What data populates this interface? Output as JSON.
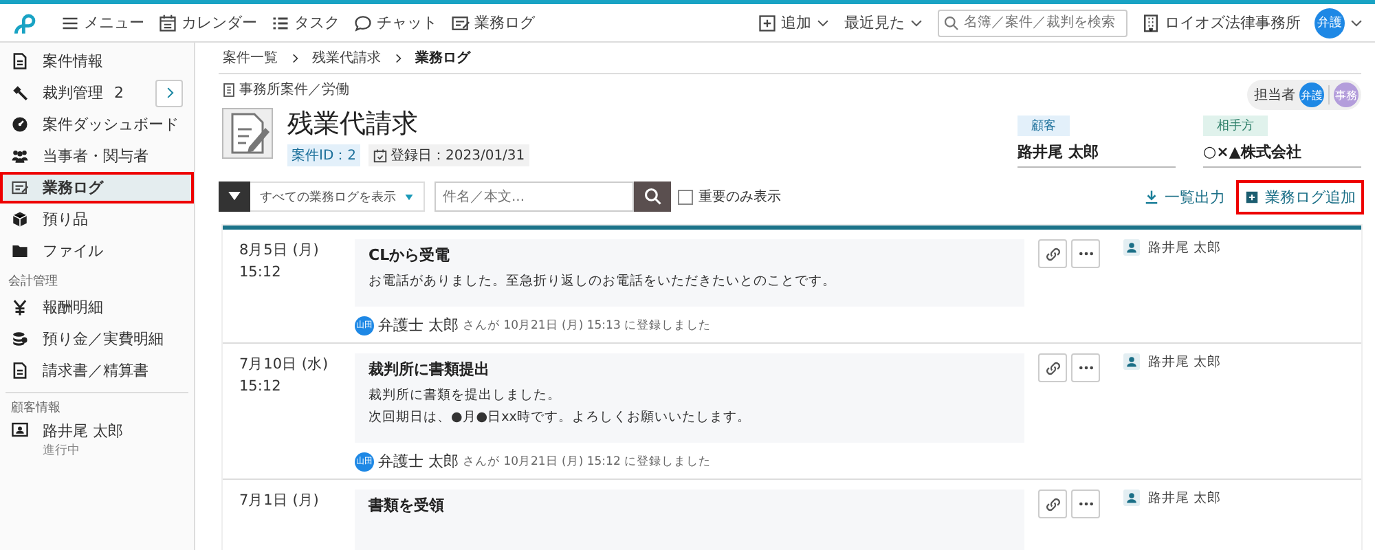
{
  "topbar": {
    "nav": [
      {
        "label": "メニュー",
        "kind": "menu"
      },
      {
        "label": "カレンダー",
        "kind": "calendar"
      },
      {
        "label": "タスク",
        "kind": "list"
      },
      {
        "label": "チャット",
        "kind": "chat"
      },
      {
        "label": "業務ログ",
        "kind": "log"
      }
    ],
    "add": "追加",
    "recent": "最近見た",
    "search": {
      "placeholder": "名簿／案件／裁判を検索"
    },
    "office": "ロイオズ法律事務所",
    "user_initials": "弁護"
  },
  "sidebar": {
    "sections": [
      {
        "items": [
          {
            "label": "案件情報",
            "kind": "doc",
            "selected": false,
            "highlighted": false
          },
          {
            "label": "裁判管理",
            "kind": "gavel",
            "count": "2",
            "expandable": true,
            "selected": false,
            "highlighted": false
          },
          {
            "label": "案件ダッシュボード",
            "kind": "gauge",
            "selected": false,
            "highlighted": false
          },
          {
            "label": "当事者・関与者",
            "kind": "people",
            "selected": false,
            "highlighted": false
          },
          {
            "label": "業務ログ",
            "kind": "log",
            "selected": true,
            "highlighted": true
          },
          {
            "label": "預り品",
            "kind": "box",
            "selected": false,
            "highlighted": false
          },
          {
            "label": "ファイル",
            "kind": "folder",
            "selected": false,
            "highlighted": false
          }
        ]
      },
      {
        "heading": "会計管理",
        "items": [
          {
            "label": "報酬明細",
            "kind": "yen",
            "selected": false,
            "highlighted": false
          },
          {
            "label": "預り金／実費明細",
            "kind": "coins",
            "selected": false,
            "highlighted": false
          },
          {
            "label": "請求書／精算書",
            "kind": "doc",
            "selected": false,
            "highlighted": false
          }
        ]
      },
      {
        "heading": "顧客情報",
        "items": [
          {
            "label": "路井尾 太郎",
            "sublabel": "進行中",
            "kind": "contact",
            "selected": false,
            "highlighted": false
          }
        ]
      }
    ]
  },
  "breadcrumb": [
    "案件一覧",
    "残業代請求",
    "業務ログ"
  ],
  "case": {
    "category": "事務所案件／労働",
    "title": "残業代請求",
    "id": "案件ID：2",
    "registered": "登録日：2023/01/31",
    "assignees_label": "担当者",
    "assignees": [
      {
        "initials": "弁護",
        "color": "#1e88e5"
      },
      {
        "initials": "事務",
        "color": "#b39ddb"
      }
    ],
    "parties": [
      {
        "role": "顧客",
        "name": "路井尾 太郎",
        "kind": "client"
      },
      {
        "role": "相手方",
        "name": "○×▲株式会社",
        "kind": "opponent"
      }
    ]
  },
  "toolbar": {
    "filter": "すべての業務ログを表示",
    "search": {
      "placeholder": "件名／本文..."
    },
    "important_only": {
      "label": "重要のみ表示",
      "checked": false
    },
    "export": "一覧出力",
    "add": {
      "label": "業務ログ追加",
      "highlighted": true
    }
  },
  "entries": [
    {
      "date": "8月5日 (月)",
      "time": "15:12",
      "title": "CLから受電",
      "body": [
        "お電話がありました。至急折り返しのお電話をいただきたいとのことです。"
      ],
      "author_initials": "山田",
      "author": "弁護士 太郎",
      "registered_note": "さんが 10月21日 (月) 15:13 に登録しました",
      "client": "路井尾 太郎"
    },
    {
      "date": "7月10日 (水)",
      "time": "15:12",
      "title": "裁判所に書類提出",
      "body": [
        "裁判所に書類を提出しました。",
        "次回期日は、●月●日xx時です。よろしくお願いいたします。"
      ],
      "author_initials": "山田",
      "author": "弁護士 太郎",
      "registered_note": "さんが 10月21日 (月) 15:12 に登録しました",
      "client": "路井尾 太郎"
    },
    {
      "date": "7月1日 (月)",
      "title": "書類を受領",
      "client": "路井尾 太郎"
    }
  ]
}
